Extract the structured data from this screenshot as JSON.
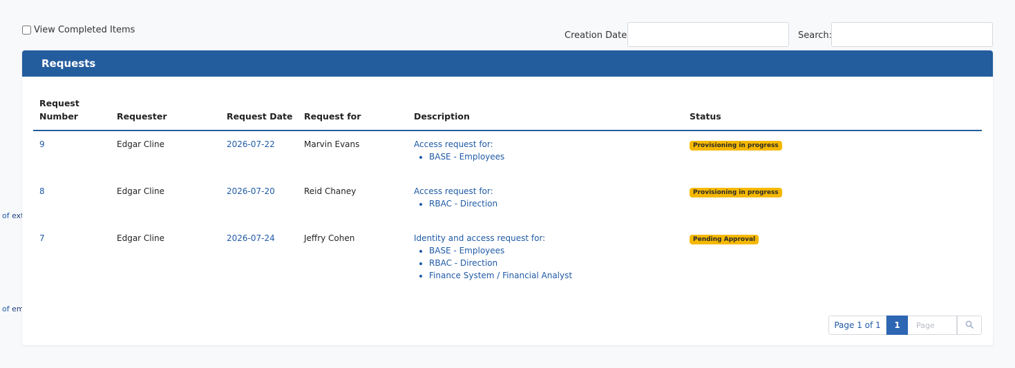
{
  "left_snippets": [
    {
      "dim": "of ",
      "strong": "ext"
    },
    {
      "dim": "of ",
      "strong": "em"
    }
  ],
  "filters": {
    "view_completed_label": "View Completed Items",
    "creation_date_label": "Creation Date:",
    "creation_date_value": "",
    "search_label": "Search:",
    "search_value": ""
  },
  "panel": {
    "title": "Requests",
    "columns": [
      "Request Number",
      "Requester",
      "Request Date",
      "Request for",
      "Description",
      "Status"
    ]
  },
  "rows": [
    {
      "number": "9",
      "requester": "Edgar Cline",
      "date": "2026-07-22",
      "request_for": "Marvin Evans",
      "desc_title": "Access request for:",
      "items": [
        "BASE - Employees"
      ],
      "status": "Provisioning in progress"
    },
    {
      "number": "8",
      "requester": "Edgar Cline",
      "date": "2026-07-20",
      "request_for": "Reid Chaney",
      "desc_title": "Access request for:",
      "items": [
        "RBAC - Direction"
      ],
      "status": "Provisioning in progress"
    },
    {
      "number": "7",
      "requester": "Edgar Cline",
      "date": "2026-07-24",
      "request_for": "Jeffry Cohen",
      "desc_title": "Identity and access request for:",
      "items": [
        "BASE - Employees",
        "RBAC - Direction",
        "Finance System / Financial Analyst"
      ],
      "status": "Pending Approval"
    }
  ],
  "pager": {
    "info": "Page 1 of 1",
    "current": "1",
    "placeholder": "Page",
    "go_icon": "search-icon"
  },
  "colors": {
    "header": "#245d9e",
    "link": "#1f5aa6",
    "badge": "#f5b800",
    "page_active": "#2d66b3"
  }
}
